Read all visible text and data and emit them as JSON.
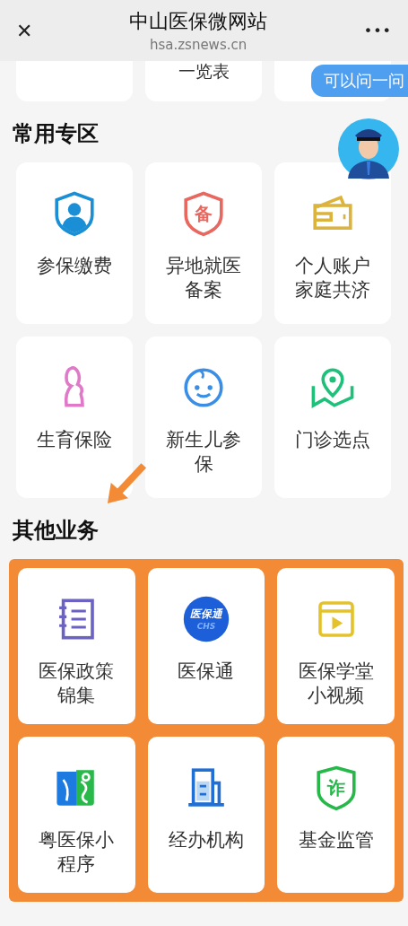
{
  "header": {
    "close": "✕",
    "title": "中山医保微网站",
    "url": "hsa.zsnews.cn",
    "more": "•••"
  },
  "top_row": [
    {
      "kind": "blank"
    },
    {
      "kind": "text",
      "label": "一览表"
    },
    {
      "kind": "blank"
    }
  ],
  "assistant": {
    "bubble": "可以问一问"
  },
  "sections": [
    {
      "title": "常用专区",
      "highlighted": false,
      "items": [
        {
          "label": "参保缴费"
        },
        {
          "label": "异地就医备案",
          "icon_text": "备"
        },
        {
          "label": "个人账户家庭共济"
        },
        {
          "label": "生育保险"
        },
        {
          "label": "新生儿参保"
        },
        {
          "label": "门诊选点"
        }
      ]
    },
    {
      "title": "其他业务",
      "highlighted": true,
      "items": [
        {
          "label": "医保政策锦集"
        },
        {
          "label": "医保通",
          "icon_text": "医保通",
          "icon_subtext": "CHS"
        },
        {
          "label": "医保学堂小视频"
        },
        {
          "label": "粤医保小程序"
        },
        {
          "label": "经办机构"
        },
        {
          "label": "基金监管",
          "icon_text": "诈"
        }
      ]
    }
  ]
}
